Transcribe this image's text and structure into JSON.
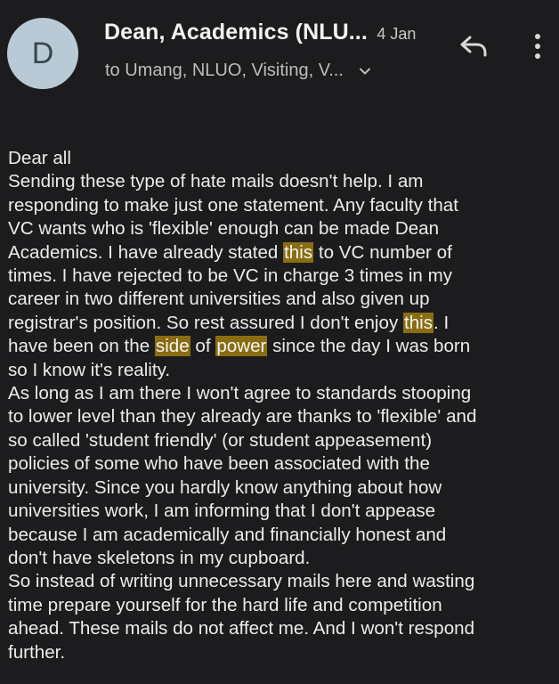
{
  "email": {
    "avatar_letter": "D",
    "sender": "Dean, Academics (NLU...",
    "date": "4 Jan",
    "recipients": "to Umang, NLUO, Visiting, V...",
    "body_lines": [
      [
        {
          "t": "Dear all"
        }
      ],
      [
        {
          "t": "Sending these type of hate mails doesn't help. I am"
        }
      ],
      [
        {
          "t": "responding to make just one statement. Any faculty that"
        }
      ],
      [
        {
          "t": "VC wants who is 'flexible' enough can be made Dean"
        }
      ],
      [
        {
          "t": "Academics. I have already stated "
        },
        {
          "t": "this",
          "hl": true
        },
        {
          "t": " to VC number of"
        }
      ],
      [
        {
          "t": "times. I have rejected to be VC in charge 3 times in my"
        }
      ],
      [
        {
          "t": "career in two different universities and also given up"
        }
      ],
      [
        {
          "t": "registrar's position. So rest assured I don't enjoy "
        },
        {
          "t": "this",
          "hl": true
        },
        {
          "t": ". I"
        }
      ],
      [
        {
          "t": "have been on the "
        },
        {
          "t": "side",
          "hl": true
        },
        {
          "t": " of "
        },
        {
          "t": "power",
          "hl": true
        },
        {
          "t": " since the day I was born"
        }
      ],
      [
        {
          "t": "so I know it's reality."
        }
      ],
      [
        {
          "t": "As long as I am there I won't agree to standards stooping"
        }
      ],
      [
        {
          "t": "to lower level than they already are thanks to 'flexible' and"
        }
      ],
      [
        {
          "t": "so called 'student friendly' (or student appeasement)"
        }
      ],
      [
        {
          "t": "policies of some who have been associated with the"
        }
      ],
      [
        {
          "t": "university. Since you hardly know anything about how"
        }
      ],
      [
        {
          "t": "universities work, I am informing that I don't appease"
        }
      ],
      [
        {
          "t": "because I am academically and financially honest and"
        }
      ],
      [
        {
          "t": "don't have skeletons in my cupboard."
        }
      ],
      [
        {
          "t": "So instead of writing unnecessary mails here and wasting"
        }
      ],
      [
        {
          "t": "time prepare yourself for the hard life and competition"
        }
      ],
      [
        {
          "t": "ahead. These mails do not affect me. And I won't respond"
        }
      ],
      [
        {
          "t": "further."
        }
      ]
    ]
  },
  "icons": {
    "reply": "reply-icon",
    "more": "more-vert-icon",
    "expand": "chevron-down-icon"
  },
  "colors": {
    "background": "#1c1c1e",
    "avatar": "#b9cad6",
    "highlight": "#8a6d12"
  }
}
